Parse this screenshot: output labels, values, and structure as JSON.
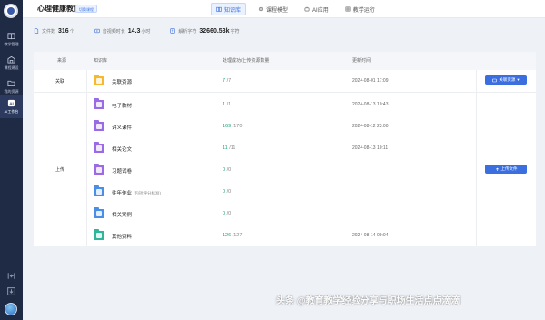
{
  "header": {
    "title": "心理健康教育",
    "switch_label": "切换课程",
    "tabs": [
      {
        "label": "知识库",
        "active": true
      },
      {
        "label": "课程模型",
        "active": false
      },
      {
        "label": "AI应用",
        "active": false
      },
      {
        "label": "教学运行",
        "active": false
      }
    ]
  },
  "sidebar": {
    "items": [
      {
        "label": "教学管理",
        "icon": "book-icon"
      },
      {
        "label": "课程建设",
        "icon": "building-icon"
      },
      {
        "label": "我的资源",
        "icon": "folder-icon"
      },
      {
        "label": "AI工作台",
        "icon": "ai-icon",
        "active": true
      }
    ]
  },
  "stats": [
    {
      "label": "文件数",
      "value": "316",
      "unit": "个"
    },
    {
      "label": "音视频时长",
      "value": "14.3",
      "unit": "小时"
    },
    {
      "label": "解析字符",
      "value": "32660.53k",
      "unit": "字符"
    }
  ],
  "table": {
    "headers": [
      "来源",
      "知识库",
      "处理成功/上传资源数量",
      "更新时间"
    ],
    "groups": [
      {
        "label": "关联",
        "button": "关联资源",
        "rows": [
          {
            "name": "关联资源",
            "success": "7",
            "total": "/7",
            "time": "2024-08-01 17:09",
            "folder_color": "#f5b82e"
          }
        ]
      },
      {
        "label": "上传",
        "button": "上传文件",
        "rows": [
          {
            "name": "电子教材",
            "success": "1",
            "total": "/1",
            "time": "2024-08-13 10:43",
            "folder_color": "#9b6be6"
          },
          {
            "name": "讲义课件",
            "success": "169",
            "total": "/170",
            "time": "2024-08-12 23:00",
            "folder_color": "#9b6be6"
          },
          {
            "name": "相关论文",
            "success": "11",
            "total": "/11",
            "time": "2024-08-13 10:11",
            "folder_color": "#9b6be6"
          },
          {
            "name": "习题试卷",
            "success": "0",
            "total": "/0",
            "time": "",
            "folder_color": "#9b6be6"
          },
          {
            "name": "往年作业",
            "sub": "(包括评分标准)",
            "success": "0",
            "total": "/0",
            "time": "",
            "folder_color": "#4a8fe6"
          },
          {
            "name": "相关案例",
            "success": "0",
            "total": "/0",
            "time": "",
            "folder_color": "#4a8fe6"
          },
          {
            "name": "其他资料",
            "success": "126",
            "total": "/127",
            "time": "2024-08-14 09:04",
            "folder_color": "#2fb59a"
          }
        ]
      }
    ]
  },
  "watermark": "头条 @教育教学经验分享与职场生活点点滴滴",
  "colors": {
    "accent": "#3b6fe0",
    "success": "#1aa36f",
    "sidebar": "#1f2a44"
  }
}
